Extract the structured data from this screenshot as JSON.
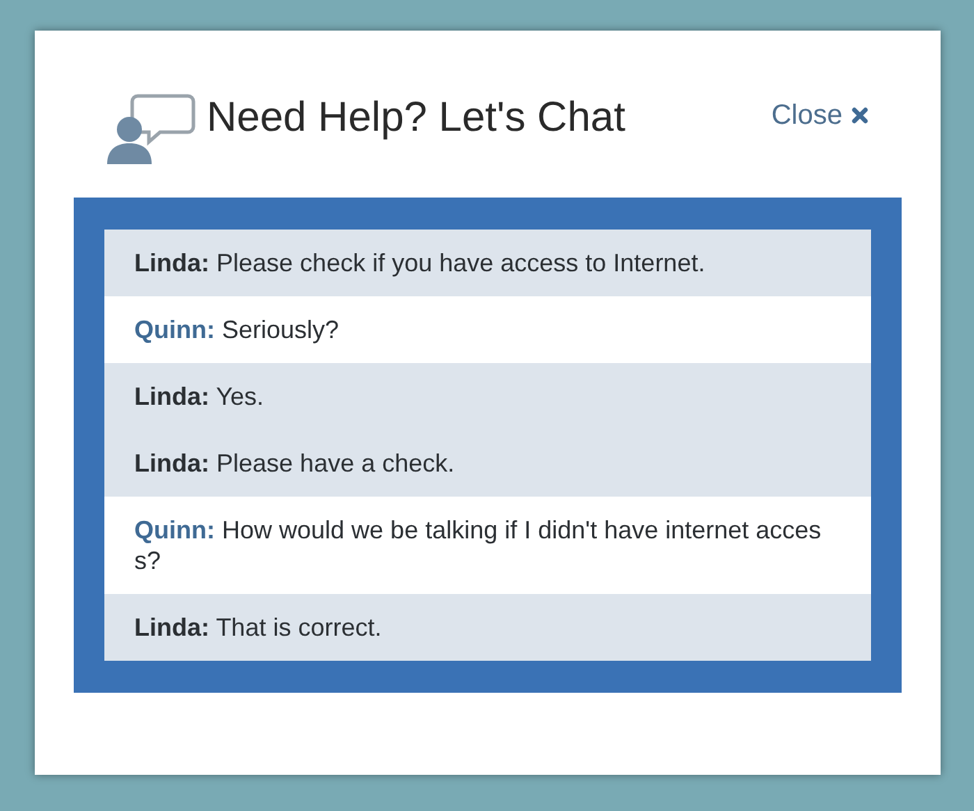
{
  "header": {
    "title": "Need Help? Let's Chat",
    "close": "Close"
  },
  "messages": [
    {
      "kind": "agent",
      "sender": "Linda:",
      "text": "Please check if you have access to Internet."
    },
    {
      "kind": "visitor",
      "sender": "Quinn:",
      "text": "Seriously?"
    },
    {
      "kind": "agent",
      "sender": "Linda:",
      "text": "Yes."
    },
    {
      "kind": "agent",
      "sender": "Linda:",
      "text": "Please have a check."
    },
    {
      "kind": "visitor",
      "sender": "Quinn:",
      "text": "How would we be talking if I didn't have internet access?"
    },
    {
      "kind": "agent",
      "sender": "Linda:",
      "text": "That is correct."
    }
  ]
}
